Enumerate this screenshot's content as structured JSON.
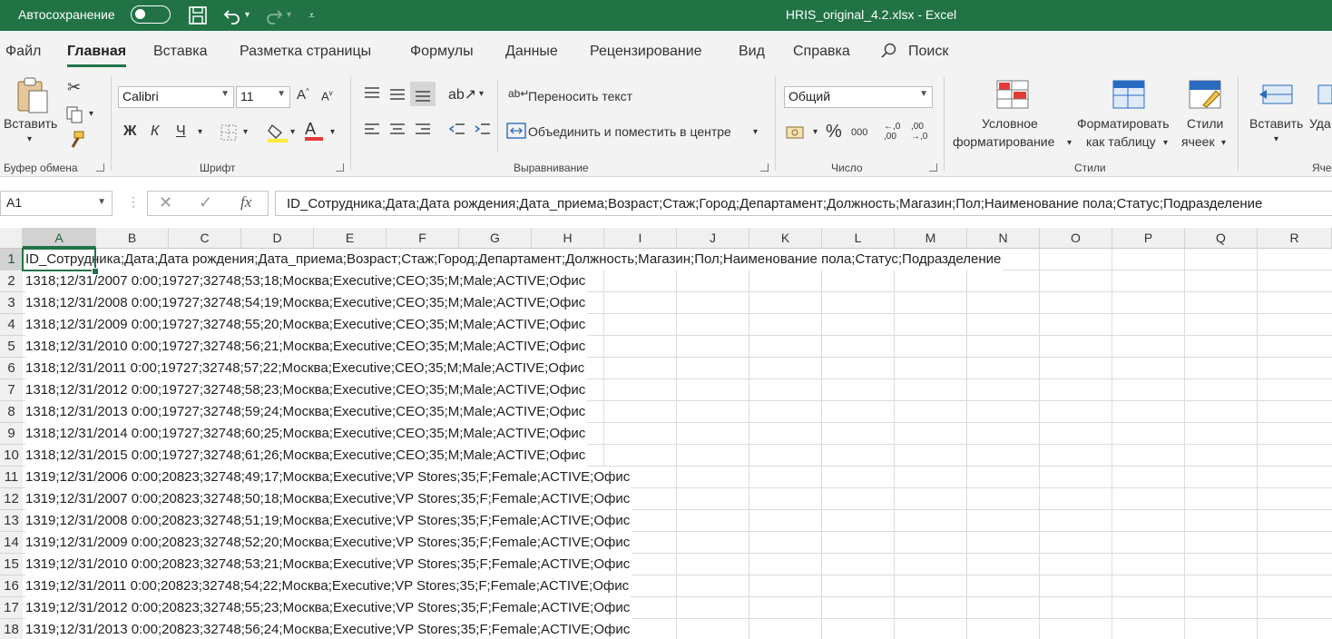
{
  "titlebar": {
    "autosave_label": "Автосохранение",
    "document_title": "HRIS_original_4.2.xlsx  -  Excel",
    "icons": [
      "save-icon",
      "undo-icon",
      "redo-icon",
      "customize-qat-icon"
    ]
  },
  "tabs": [
    {
      "label": "Файл"
    },
    {
      "label": "Главная",
      "active": true
    },
    {
      "label": "Вставка"
    },
    {
      "label": "Разметка страницы"
    },
    {
      "label": "Формулы"
    },
    {
      "label": "Данные"
    },
    {
      "label": "Рецензирование"
    },
    {
      "label": "Вид"
    },
    {
      "label": "Справка"
    },
    {
      "label": "Поиск"
    }
  ],
  "ribbon": {
    "clipboard": {
      "paste_label": "Вставить",
      "group_label": "Буфер обмена"
    },
    "font": {
      "font_name": "Calibri",
      "font_size": "11",
      "bold": "Ж",
      "italic": "К",
      "underline": "Ч",
      "group_label": "Шрифт"
    },
    "alignment": {
      "wrap_text": "Переносить текст",
      "merge_center": "Объединить и поместить в центре",
      "group_label": "Выравнивание"
    },
    "number": {
      "format": "Общий",
      "percent": "%",
      "thousands": "000",
      "group_label": "Число"
    },
    "styles": {
      "conditional_line1": "Условное",
      "conditional_line2": "форматирование",
      "format_table_line1": "Форматировать",
      "format_table_line2": "как таблицу",
      "cell_styles_line1": "Стили",
      "cell_styles_line2": "ячеек",
      "group_label": "Стили"
    },
    "cells": {
      "insert_label": "Вставить",
      "delete_label": "Уда",
      "group_label": "Яче"
    }
  },
  "formula_bar": {
    "name_box": "A1",
    "fx": "fx",
    "formula": "ID_Сотрудника;Дата;Дата рождения;Дата_приема;Возраст;Стаж;Город;Департамент;Должность;Магазин;Пол;Наименование пола;Статус;Подразделение"
  },
  "sheet": {
    "columns": [
      "A",
      "B",
      "C",
      "D",
      "E",
      "F",
      "G",
      "H",
      "I",
      "J",
      "K",
      "L",
      "M",
      "N",
      "O",
      "P",
      "Q",
      "R"
    ],
    "selected_cell": "A1",
    "rows": [
      {
        "num": "1",
        "a": "ID_Сотрудника;Дата;Дата рождения;Дата_приема;Возраст;Стаж;Город;Департамент;Должность;Магазин;Пол;Наименование пола;Статус;Подразделение"
      },
      {
        "num": "2",
        "a": "1318;12/31/2007 0:00;19727;32748;53;18;Москва;Executive;CEO;35;M;Male;ACTIVE;Офис"
      },
      {
        "num": "3",
        "a": "1318;12/31/2008 0:00;19727;32748;54;19;Москва;Executive;CEO;35;M;Male;ACTIVE;Офис"
      },
      {
        "num": "4",
        "a": "1318;12/31/2009 0:00;19727;32748;55;20;Москва;Executive;CEO;35;M;Male;ACTIVE;Офис"
      },
      {
        "num": "5",
        "a": "1318;12/31/2010 0:00;19727;32748;56;21;Москва;Executive;CEO;35;M;Male;ACTIVE;Офис"
      },
      {
        "num": "6",
        "a": "1318;12/31/2011 0:00;19727;32748;57;22;Москва;Executive;CEO;35;M;Male;ACTIVE;Офис"
      },
      {
        "num": "7",
        "a": "1318;12/31/2012 0:00;19727;32748;58;23;Москва;Executive;CEO;35;M;Male;ACTIVE;Офис"
      },
      {
        "num": "8",
        "a": "1318;12/31/2013 0:00;19727;32748;59;24;Москва;Executive;CEO;35;M;Male;ACTIVE;Офис"
      },
      {
        "num": "9",
        "a": "1318;12/31/2014 0:00;19727;32748;60;25;Москва;Executive;CEO;35;M;Male;ACTIVE;Офис"
      },
      {
        "num": "10",
        "a": "1318;12/31/2015 0:00;19727;32748;61;26;Москва;Executive;CEO;35;M;Male;ACTIVE;Офис"
      },
      {
        "num": "11",
        "a": "1319;12/31/2006 0:00;20823;32748;49;17;Москва;Executive;VP Stores;35;F;Female;ACTIVE;Офис"
      },
      {
        "num": "12",
        "a": "1319;12/31/2007 0:00;20823;32748;50;18;Москва;Executive;VP Stores;35;F;Female;ACTIVE;Офис"
      },
      {
        "num": "13",
        "a": "1319;12/31/2008 0:00;20823;32748;51;19;Москва;Executive;VP Stores;35;F;Female;ACTIVE;Офис"
      },
      {
        "num": "14",
        "a": "1319;12/31/2009 0:00;20823;32748;52;20;Москва;Executive;VP Stores;35;F;Female;ACTIVE;Офис"
      },
      {
        "num": "15",
        "a": "1319;12/31/2010 0:00;20823;32748;53;21;Москва;Executive;VP Stores;35;F;Female;ACTIVE;Офис"
      },
      {
        "num": "16",
        "a": "1319;12/31/2011 0:00;20823;32748;54;22;Москва;Executive;VP Stores;35;F;Female;ACTIVE;Офис"
      },
      {
        "num": "17",
        "a": "1319;12/31/2012 0:00;20823;32748;55;23;Москва;Executive;VP Stores;35;F;Female;ACTIVE;Офис"
      },
      {
        "num": "18",
        "a": "1319;12/31/2013 0:00;20823;32748;56;24;Москва;Executive;VP Stores;35;F;Female;ACTIVE;Офис"
      }
    ]
  },
  "colors": {
    "excel_green": "#217346",
    "ribbon_bg": "#f3f3f3",
    "header_bg": "#f0f0f0"
  }
}
